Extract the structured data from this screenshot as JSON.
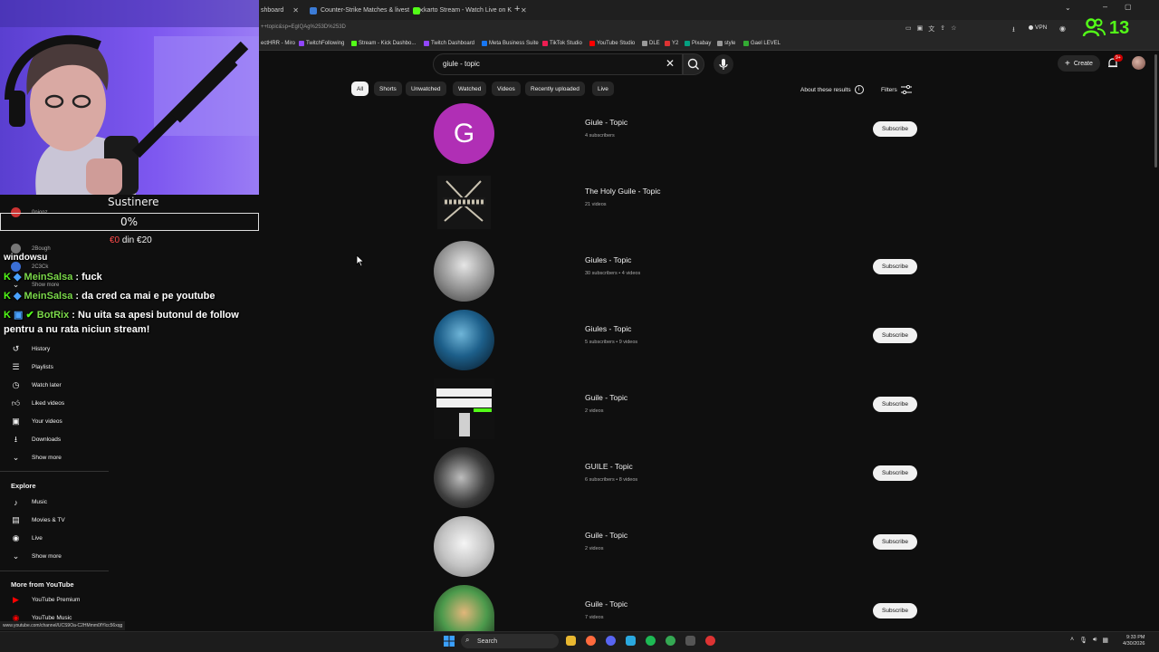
{
  "browser": {
    "tabs": [
      {
        "label": "shboard"
      },
      {
        "label": "Counter-Strike Matches & livest"
      },
      {
        "label": "karto Stream - Watch Live on K"
      }
    ],
    "url": "++topic&sp=EgIQAg%253D%253D",
    "bookmarks": [
      "ectHRR - Miro",
      "TwitchFollowing",
      "Stream - Kick Dashbo...",
      "Twitch Dashboard",
      "Meta Business Suite",
      "TikTok Studio",
      "YouTube Studio",
      "DLE",
      "Y2",
      "Pixabay",
      "style",
      "Gael LEVEL"
    ],
    "vpn_label": "VPN",
    "viewer_count": "13"
  },
  "header": {
    "search_query": "giule - topic",
    "create_label": "Create",
    "notif_badge": "9+"
  },
  "chips": [
    "All",
    "Shorts",
    "Unwatched",
    "Watched",
    "Videos",
    "Recently uploaded",
    "Live"
  ],
  "about_results": "About these results",
  "filters_label": "Filters",
  "results": [
    {
      "name": "Giule - Topic",
      "meta": "4 subscribers",
      "subscribe": "Subscribe"
    },
    {
      "name": "The Holy Guile - Topic",
      "meta": "21 videos",
      "subscribe": ""
    },
    {
      "name": "Giules - Topic",
      "meta": "30 subscribers • 4 videos",
      "subscribe": "Subscribe"
    },
    {
      "name": "Giules - Topic",
      "meta": "5 subscribers • 9 videos",
      "subscribe": "Subscribe"
    },
    {
      "name": "Guile - Topic",
      "meta": "2 videos",
      "subscribe": "Subscribe"
    },
    {
      "name": "GUILE - Topic",
      "meta": "6 subscribers • 8 videos",
      "subscribe": "Subscribe"
    },
    {
      "name": "Guile - Topic",
      "meta": "2 videos",
      "subscribe": "Subscribe"
    },
    {
      "name": "Guile - Topic",
      "meta": "7 videos",
      "subscribe": "Subscribe"
    }
  ],
  "avatar_letter": "G",
  "sidebar": {
    "subs": [
      "0nionz",
      "2Bough",
      "2C3Ck"
    ],
    "show_more_1": "Show more",
    "you_items": [
      "History",
      "Playlists",
      "Watch later",
      "Liked videos",
      "Your videos",
      "Downloads",
      "Show more"
    ],
    "explore_title": "Explore",
    "explore_items": [
      "Music",
      "Movies & TV",
      "Live",
      "Show more"
    ],
    "more_title": "More from YouTube",
    "more_items": [
      "YouTube Premium",
      "YouTube Music"
    ]
  },
  "donation": {
    "title": "Sustinere",
    "percent": "0%",
    "amount_current": "€0",
    "amount_rest": " din €20"
  },
  "chat": {
    "line0": "windowsu",
    "line1_user": "MeinSalsa",
    "line1_msg": " : fuck",
    "line2_user": "MeinSalsa",
    "line2_msg": " : da cred ca mai e pe youtube",
    "line3_user": "BotRix",
    "line3_msg": " : Nu uita sa apesi butonul de follow",
    "line4": "pentru a nu rata niciun stream!"
  },
  "statusbar_url": "www.youtube.com/channel/UCS9Oa-C2HMmm0fYlcc56xqg",
  "taskbar": {
    "search_label": "Search",
    "time": "9:33 PM",
    "date": "4/30/2026"
  },
  "colors": {
    "bg": "#0f0f0f",
    "chip_active": "#f1f1f1",
    "chat_user": "#7bd94a",
    "avatar_purple": "#b02fb5"
  }
}
